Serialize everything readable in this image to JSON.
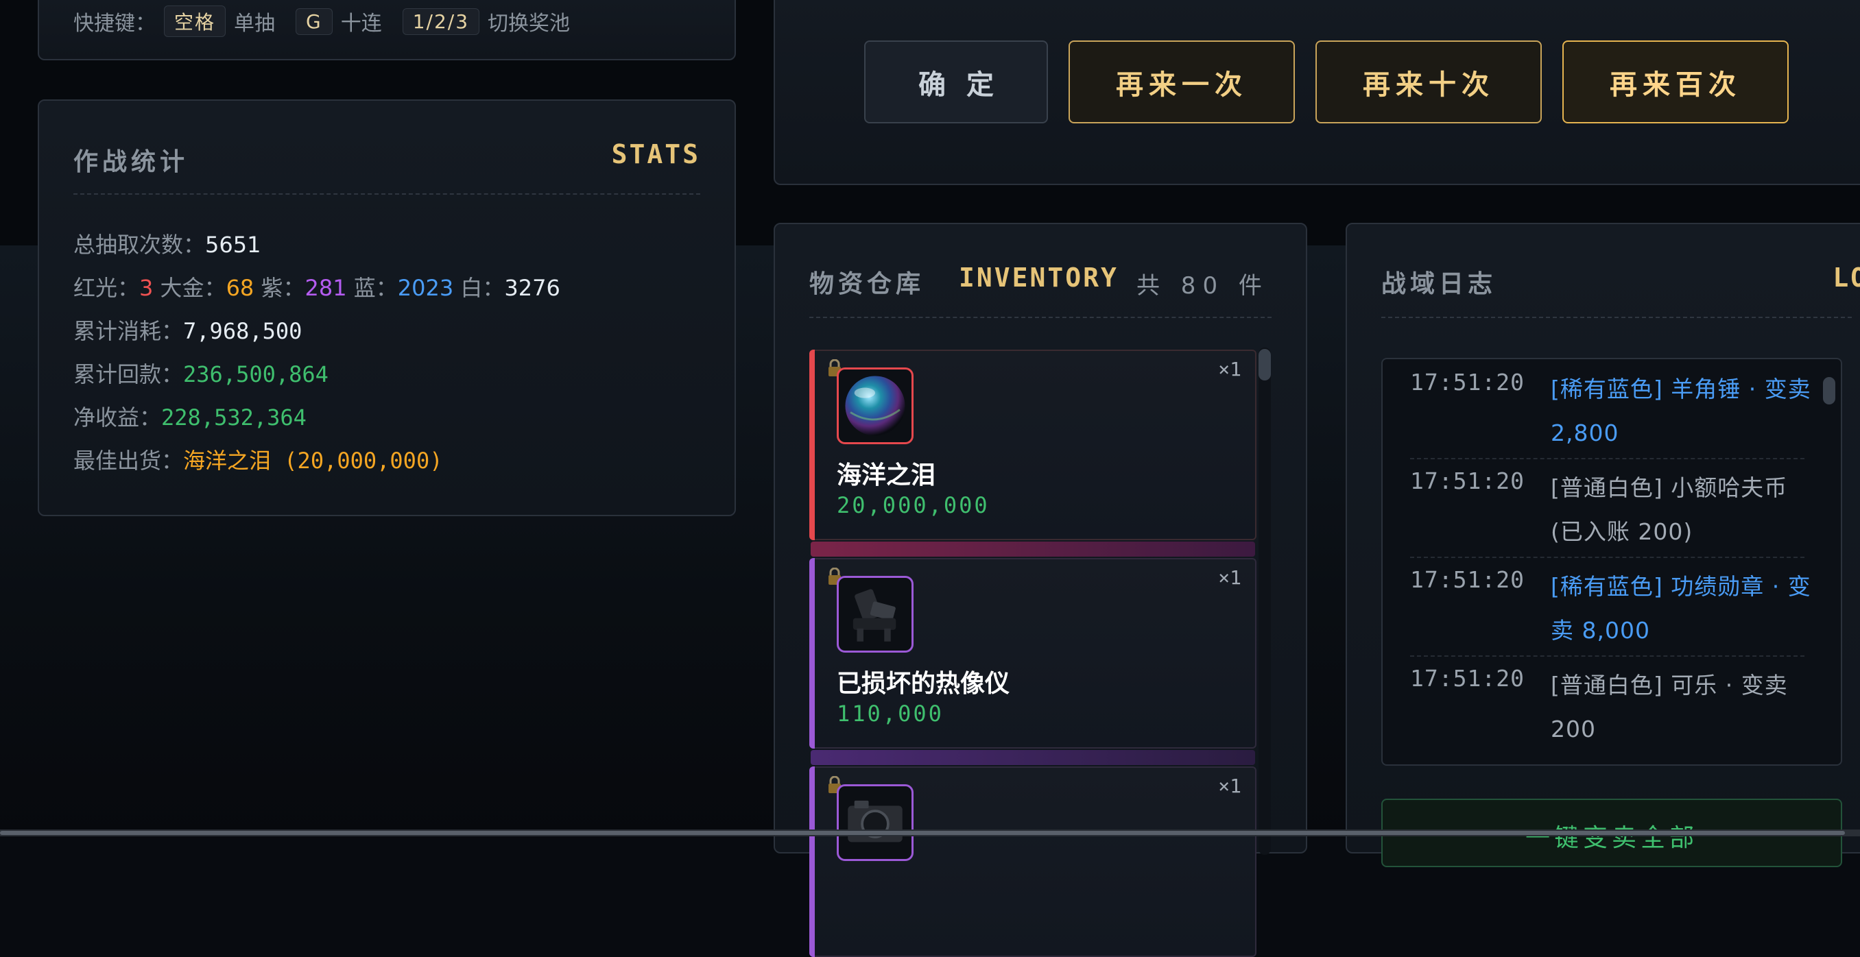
{
  "shortcuts": {
    "label": "快捷键：",
    "key_space": "空格",
    "space_action": "单抽",
    "key_g": "G",
    "g_action": "十连",
    "key_pool": "1/2/3",
    "pool_action": "切换奖池"
  },
  "stats": {
    "title": "作战统计",
    "tag": "STATS",
    "total_label": "总抽取次数：",
    "total_value": "5651",
    "red_label": "红光：",
    "red_value": "3",
    "gold_label": "大金：",
    "gold_value": "68",
    "purple_label": "紫：",
    "purple_value": "281",
    "blue_label": "蓝：",
    "blue_value": "2023",
    "white_label": "白：",
    "white_value": "3276",
    "cost_label": "累计消耗：",
    "cost_value": "7,968,500",
    "return_label": "累计回款：",
    "return_value": "236,500,864",
    "net_label": "净收益：",
    "net_value": "228,532,364",
    "best_label": "最佳出货：",
    "best_value": "海洋之泪 (20,000,000)"
  },
  "actions": {
    "confirm": "确定",
    "once": "再来一次",
    "ten": "再来十次",
    "hundred": "再来百次"
  },
  "inventory": {
    "title": "物资仓库",
    "tag": "INVENTORY",
    "count": "共 80 件",
    "items": [
      {
        "name": "海洋之泪",
        "price": "20,000,000",
        "qty": "×1",
        "rarity": "red",
        "color": "#e5484d",
        "icon": "orb-icon"
      },
      {
        "name": "已损坏的热像仪",
        "price": "110,000",
        "qty": "×1",
        "rarity": "purple",
        "color": "#9b59d6",
        "icon": "thermal-imager-icon"
      },
      {
        "name": "",
        "price": "",
        "qty": "×1",
        "rarity": "purple",
        "color": "#9b59d6",
        "icon": "camera-icon"
      }
    ]
  },
  "log": {
    "title": "战域日志",
    "tag": "LOG",
    "entries": [
      {
        "time": "17:51:20",
        "text": "[稀有蓝色] 羊角锤 · 变卖 2,800",
        "style": "blue"
      },
      {
        "time": "17:51:20",
        "text": "[普通白色] 小额哈夫币 (已入账 200)",
        "style": "grey"
      },
      {
        "time": "17:51:20",
        "text": "[稀有蓝色] 功绩勋章 · 变卖 8,000",
        "style": "blue"
      },
      {
        "time": "17:51:20",
        "text": "[普通白色] 可乐 · 变卖 200",
        "style": "grey"
      }
    ],
    "sell_all": "一键变卖全部"
  }
}
